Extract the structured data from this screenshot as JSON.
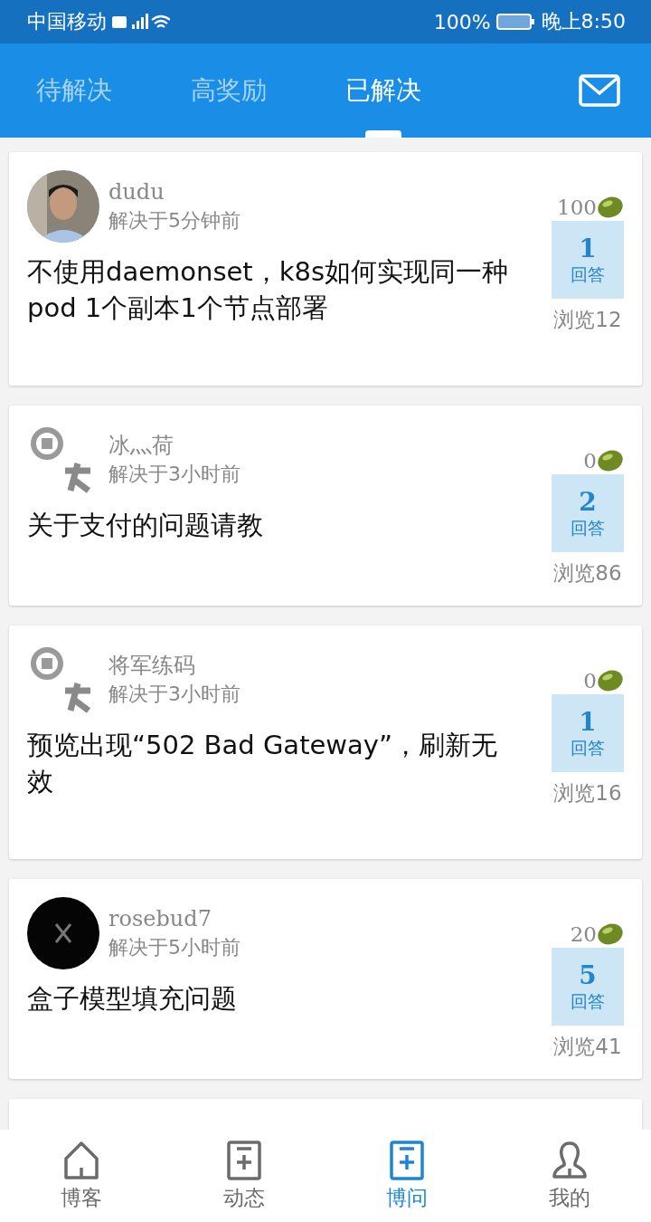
{
  "status_bar": {
    "carrier": "中国移动",
    "battery": "100%",
    "time": "晚上8:50"
  },
  "tabs": [
    {
      "label": "待解决",
      "selected": false
    },
    {
      "label": "高奖励",
      "selected": false
    },
    {
      "label": "已解决",
      "selected": true
    }
  ],
  "questions": [
    {
      "user": "dudu",
      "time": "解决于5分钟前",
      "title": "不使用daemonset，k8s如何实现同一种 pod 1个副本1个节点部署",
      "bounty": "100",
      "answers": "1",
      "answers_label": "回答",
      "views": "浏览12"
    },
    {
      "avatar": {
        "kind": "placeholder"
      },
      "user": "冰灬荷",
      "time": "解决于3小时前",
      "title": "关于支付的问题请教",
      "bounty": "0",
      "answers": "2",
      "answers_label": "回答",
      "views": "浏览86"
    },
    {
      "avatar": {
        "kind": "placeholder"
      },
      "user": "将军练码",
      "time": "解决于3小时前",
      "title": "预览出现“502 Bad Gateway”，刷新无效",
      "bounty": "0",
      "answers": "1",
      "answers_label": "回答",
      "views": "浏览16"
    },
    {
      "avatar": {
        "kind": "dark"
      },
      "user": "rosebud7",
      "time": "解决于5小时前",
      "title": "盒子模型填充问题",
      "bounty": "20",
      "answers": "5",
      "answers_label": "回答",
      "views": "浏览41"
    }
  ],
  "bottom_nav": [
    {
      "label": "博客",
      "kind": "home",
      "selected": false
    },
    {
      "label": "动态",
      "kind": "compose",
      "selected": false
    },
    {
      "label": "博问",
      "kind": "compose",
      "selected": true
    },
    {
      "label": "我的",
      "kind": "profile",
      "selected": false
    }
  ]
}
